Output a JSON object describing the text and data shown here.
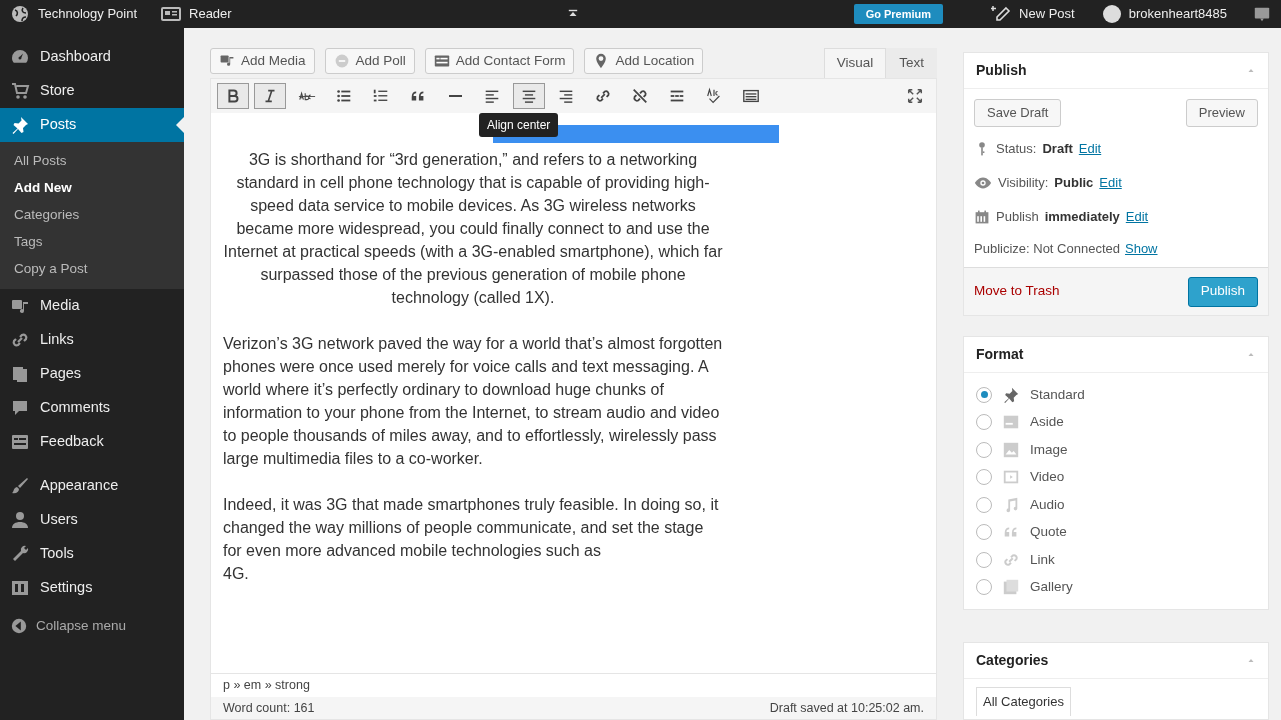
{
  "admin_bar": {
    "site": "Technology Point",
    "reader": "Reader",
    "go_premium": "Go Premium",
    "new_post": "New Post",
    "user": "brokenheart8485"
  },
  "menu": {
    "items": [
      {
        "label": "Dashboard",
        "selected": false
      },
      {
        "label": "Store",
        "selected": false
      },
      {
        "label": "Posts",
        "selected": true,
        "children": [
          {
            "label": "All Posts",
            "selected": false
          },
          {
            "label": "Add New",
            "selected": true
          },
          {
            "label": "Categories",
            "selected": false
          },
          {
            "label": "Tags",
            "selected": false
          },
          {
            "label": "Copy a Post",
            "selected": false
          }
        ]
      },
      {
        "label": "Media",
        "selected": false
      },
      {
        "label": "Links",
        "selected": false
      },
      {
        "label": "Pages",
        "selected": false
      },
      {
        "label": "Comments",
        "selected": false
      },
      {
        "label": "Feedback",
        "selected": false
      },
      {
        "label": "Appearance",
        "selected": false
      },
      {
        "label": "Users",
        "selected": false
      },
      {
        "label": "Tools",
        "selected": false
      },
      {
        "label": "Settings",
        "selected": false
      }
    ],
    "collapse": "Collapse menu"
  },
  "editor": {
    "media_buttons": [
      "Add Media",
      "Add Poll",
      "Add Contact Form",
      "Add Location"
    ],
    "tabs": [
      {
        "label": "Visual",
        "selected": true
      },
      {
        "label": "Text",
        "selected": false
      }
    ],
    "toolbar": [
      {
        "kind": "bold",
        "active": true
      },
      {
        "kind": "italic",
        "active": true
      },
      {
        "kind": "strike",
        "active": false
      },
      {
        "kind": "bullets",
        "active": false
      },
      {
        "kind": "numbers",
        "active": false
      },
      {
        "kind": "quote",
        "active": false
      },
      {
        "kind": "hr",
        "active": false
      },
      {
        "kind": "alignleft",
        "active": false
      },
      {
        "kind": "aligncenter",
        "active": true
      },
      {
        "kind": "alignright",
        "active": false
      },
      {
        "kind": "link",
        "active": false
      },
      {
        "kind": "unlink",
        "active": false
      },
      {
        "kind": "more",
        "active": false
      },
      {
        "kind": "spell",
        "active": false
      },
      {
        "kind": "kitchen",
        "active": false
      }
    ],
    "tooltip": "Align center",
    "paragraphs": [
      {
        "centered": true,
        "text": "3G is shorthand for “3rd generation,” and refers to a networking standard in cell phone technology that is capable of providing high-speed data service to mobile devices. As 3G wireless networks became more widespread, you could finally connect to and use the Internet at practical speeds (with a 3G-enabled smartphone), which far surpassed those of the previous generation of mobile phone technology (called 1X)."
      },
      {
        "centered": false,
        "text": "Verizon’s 3G network paved the way for a world that’s almost forgotten phones were once used merely for voice calls and text messaging. A world where it’s perfectly ordinary to download huge chunks of information to your phone from the Internet, to stream audio and video to people thousands of miles away, and to effortlessly, wirelessly pass large multimedia files to a co-worker."
      },
      {
        "centered": false,
        "text": "Indeed, it was 3G that made smartphones truly feasible. In doing so, it changed the way millions of people communicate, and set the stage for even more advanced mobile technologies such as\n4G."
      }
    ],
    "path": "p » em » strong",
    "word_count": "Word count: 161",
    "draft_saved": "Draft saved at 10:25:02 am."
  },
  "publish": {
    "title": "Publish",
    "save_draft": "Save Draft",
    "preview": "Preview",
    "status_label": "Status:",
    "status": "Draft",
    "visibility_label": "Visibility:",
    "visibility": "Public",
    "schedule_label": "Publish",
    "schedule": "immediately",
    "status_edit": "Edit",
    "visibility_edit": "Edit",
    "schedule_edit": "Edit",
    "publicize": "Publicize: Not Connected",
    "show": "Show",
    "trash": "Move to Trash",
    "publish": "Publish"
  },
  "format": {
    "title": "Format",
    "options": [
      {
        "label": "Standard",
        "selected": true
      },
      {
        "label": "Aside",
        "selected": false
      },
      {
        "label": "Image",
        "selected": false
      },
      {
        "label": "Video",
        "selected": false
      },
      {
        "label": "Audio",
        "selected": false
      },
      {
        "label": "Quote",
        "selected": false
      },
      {
        "label": "Link",
        "selected": false
      },
      {
        "label": "Gallery",
        "selected": false
      }
    ]
  },
  "categories": {
    "title": "Categories",
    "tab": "All Categories"
  }
}
